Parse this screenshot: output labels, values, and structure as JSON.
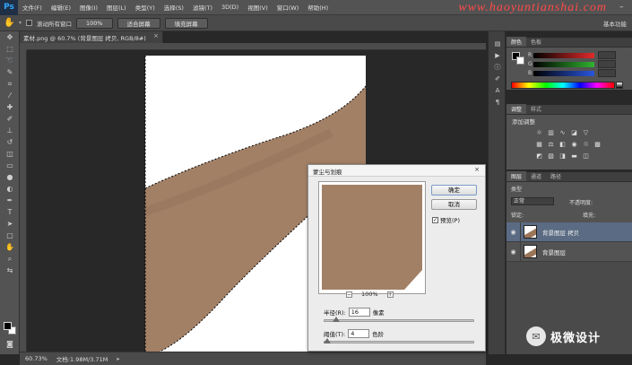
{
  "app": {
    "logo": "Ps"
  },
  "menu": [
    "文件(F)",
    "编辑(E)",
    "图像(I)",
    "图层(L)",
    "类型(Y)",
    "选择(S)",
    "滤镜(T)",
    "3D(D)",
    "视图(V)",
    "窗口(W)",
    "帮助(H)"
  ],
  "watermark": "www.haoyuntianshai.com",
  "options_bar": {
    "checkbox_label": "滚动所有窗口",
    "zoom_button": "100%",
    "fit_button": "适合屏幕",
    "fill_button": "填充屏幕",
    "workspace": "基本功能"
  },
  "document": {
    "tab_title": "素材.png @ 60.7% (背景图层 拷贝, RGB/8#)",
    "tab_close": "×",
    "zoom": "60.73%",
    "doc_info": "文档:1.98M/3.71M"
  },
  "dialog": {
    "title": "蒙尘与划痕",
    "close": "×",
    "ok": "确定",
    "cancel": "取消",
    "preview_label": "预览(P)",
    "preview_checked": true,
    "zoom_value": "100%",
    "zoom_minus": "−",
    "zoom_plus": "+",
    "radius_label": "半径(R):",
    "radius_value": "16",
    "radius_unit": "像素",
    "radius_slider_fraction": 0.08,
    "threshold_label": "阈值(T):",
    "threshold_value": "4",
    "threshold_unit": "色阶",
    "threshold_slider_fraction": 0.02
  },
  "color_panel": {
    "tabs": [
      "颜色",
      "色板"
    ],
    "channels": [
      "R",
      "G",
      "B"
    ],
    "colors": {
      "red": "#e12a2a",
      "green": "#2fb42f",
      "blue": "#2a55e0"
    }
  },
  "adjustments_panel": {
    "tabs": [
      "调整",
      "样式"
    ],
    "header": "添加调整"
  },
  "layers_panel": {
    "tabs": [
      "图层",
      "通道",
      "路径"
    ],
    "kind": "类型",
    "blend_mode": "正常",
    "opacity_label": "不透明度:",
    "lock_label": "锁定:",
    "fill_label": "填充:",
    "layers": [
      {
        "name": "背景图层 拷贝",
        "selected": true
      },
      {
        "name": "背景图层",
        "selected": false
      }
    ]
  },
  "branding": {
    "wechat_text": "极微设计"
  },
  "skin_color": "#a28066"
}
